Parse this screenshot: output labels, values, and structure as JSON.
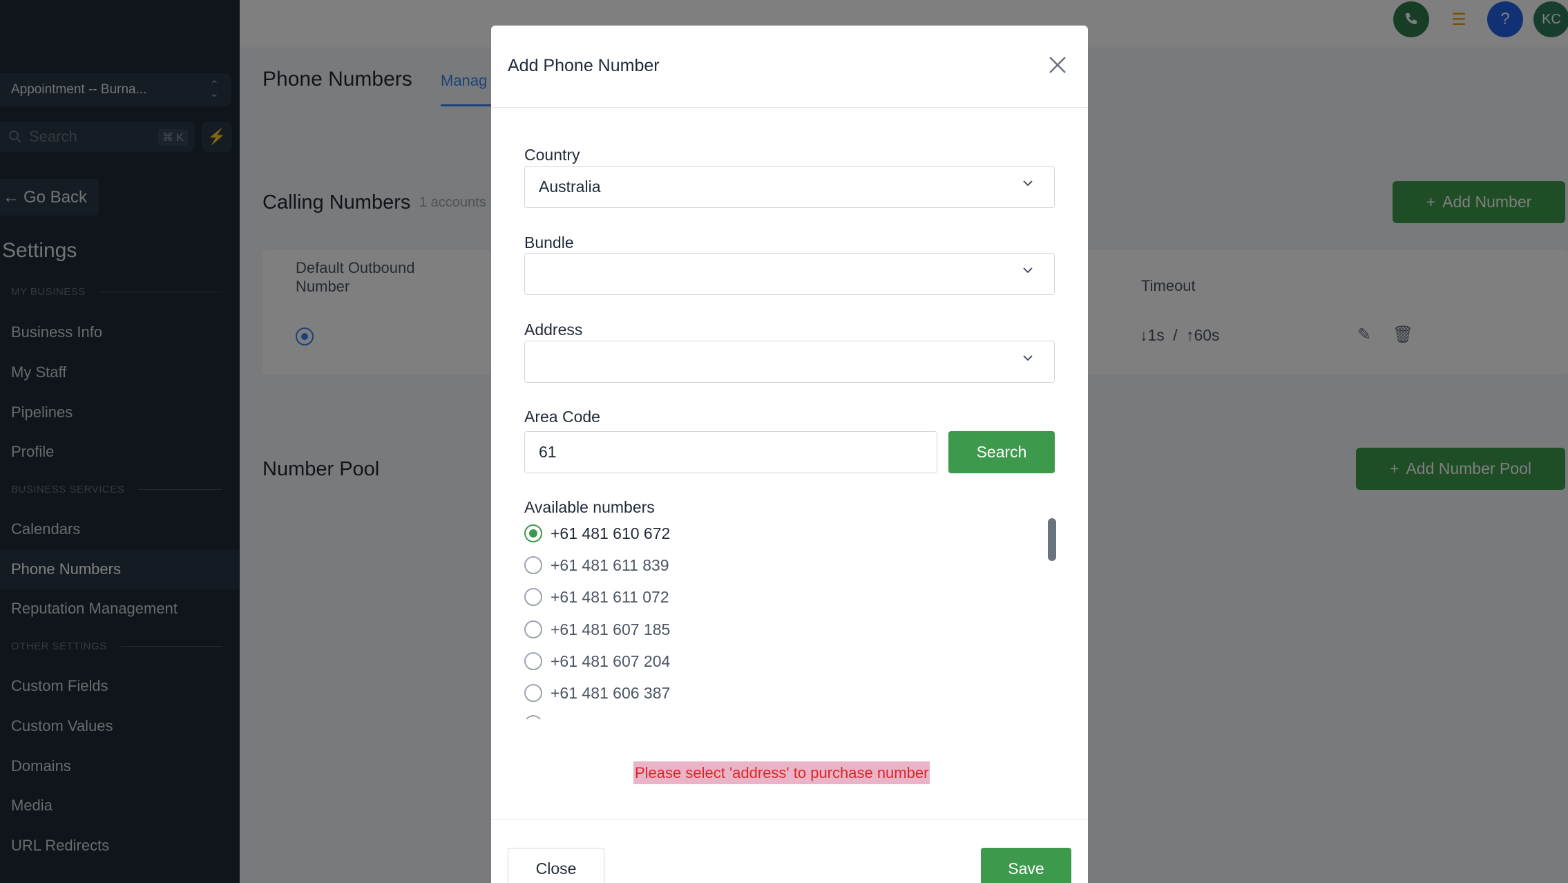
{
  "sidebar": {
    "location": "Appointment -- Burna...",
    "search_placeholder": "Search",
    "search_shortcut": "⌘ K",
    "go_back": "Go Back",
    "title": "Settings",
    "sections": [
      {
        "heading": "MY BUSINESS",
        "items": [
          "Business Info",
          "My Staff",
          "Pipelines",
          "Profile"
        ]
      },
      {
        "heading": "BUSINESS SERVICES",
        "items": [
          "Calendars",
          "Phone Numbers",
          "Reputation Management"
        ]
      },
      {
        "heading": "OTHER SETTINGS",
        "items": [
          "Custom Fields",
          "Custom Values",
          "Domains",
          "Media",
          "URL Redirects"
        ]
      }
    ],
    "active_item": "Phone Numbers"
  },
  "topbar": {
    "avatar_initials": "KC",
    "help": "?",
    "colors": {
      "phone": "#2f7d4a",
      "help": "#2563eb",
      "avatar": "#2f7d5a"
    }
  },
  "main": {
    "page_title": "Phone Numbers",
    "tab_manage": "Manag",
    "calling_title": "Calling Numbers",
    "accounts_sub": "1 accounts",
    "add_number": "Add Number",
    "columns": {
      "default_outbound": "Default Outbound Number",
      "timeout": "Timeout"
    },
    "timeout_in": "1s",
    "timeout_sep": "/",
    "timeout_out": "60s",
    "number_pool_title": "Number Pool",
    "add_number_pool": "Add Number Pool"
  },
  "modal": {
    "title": "Add Phone Number",
    "country_label": "Country",
    "country_value": "Australia",
    "bundle_label": "Bundle",
    "bundle_value": "",
    "address_label": "Address",
    "address_value": "",
    "area_code_label": "Area Code",
    "area_code_value": "61",
    "search_button": "Search",
    "available_label": "Available numbers",
    "numbers": [
      {
        "number": "+61 481 610 672",
        "selected": true
      },
      {
        "number": "+61 481 611 839",
        "selected": false
      },
      {
        "number": "+61 481 611 072",
        "selected": false
      },
      {
        "number": "+61 481 607 185",
        "selected": false
      },
      {
        "number": "+61 481 607 204",
        "selected": false
      },
      {
        "number": "+61 481 606 387",
        "selected": false
      }
    ],
    "error": "Please select 'address' to purchase number",
    "close_button": "Close",
    "save_button": "Save",
    "accent_color": "#3d9a4c",
    "error_color": "#dc2626"
  }
}
